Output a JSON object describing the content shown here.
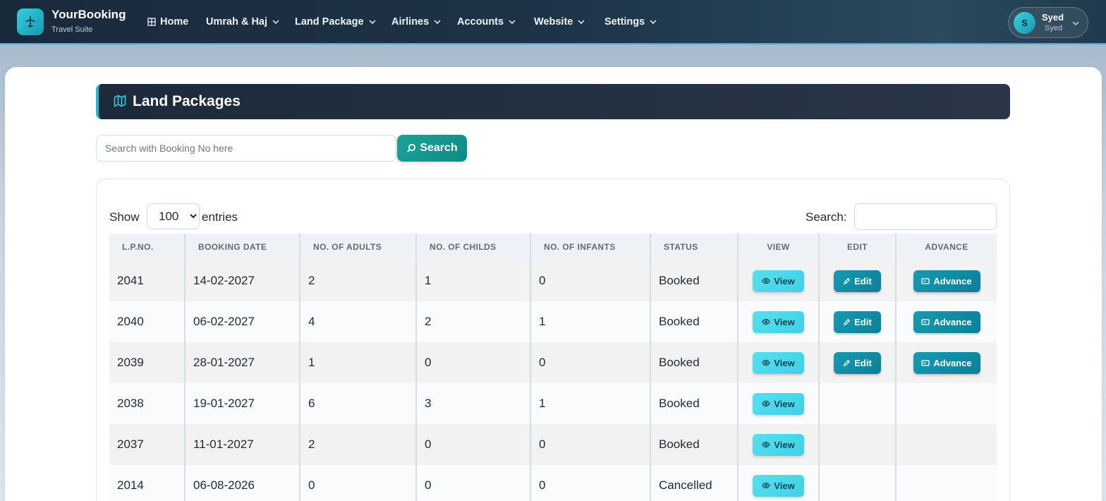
{
  "brand": {
    "name": "YourBooking",
    "subtitle": "Travel Suite"
  },
  "nav": {
    "items": [
      {
        "label": "Home",
        "icon": "grid-icon",
        "dropdown": false
      },
      {
        "label": "Umrah & Haj",
        "dropdown": true
      },
      {
        "label": "Land Package",
        "dropdown": true
      },
      {
        "label": "Airlines",
        "dropdown": true
      },
      {
        "label": "Accounts",
        "dropdown": true
      },
      {
        "label": "Website",
        "dropdown": true
      },
      {
        "label": "Settings",
        "dropdown": true
      }
    ]
  },
  "user": {
    "initial": "S",
    "name": "Syed",
    "role": "Syed"
  },
  "page": {
    "title": "Land Packages",
    "title_icon": "map-icon"
  },
  "search": {
    "placeholder": "Search with Booking No here",
    "button_label": "Search"
  },
  "table_controls": {
    "show_label": "Show",
    "entries_value": "100",
    "entries_label": "entries",
    "search_label": "Search:"
  },
  "table": {
    "headers": [
      "L.P.NO.",
      "BOOKING DATE",
      "NO. OF ADULTS",
      "NO. OF CHILDS",
      "NO. OF INFANTS",
      "STATUS",
      "VIEW",
      "EDIT",
      "ADVANCE"
    ],
    "button_labels": {
      "view": "View",
      "edit": "Edit",
      "advance": "Advance"
    },
    "rows": [
      {
        "lp_no": "2041",
        "date": "14-02-2027",
        "adults": "2",
        "childs": "1",
        "infants": "0",
        "status": "Booked",
        "editable": true
      },
      {
        "lp_no": "2040",
        "date": "06-02-2027",
        "adults": "4",
        "childs": "2",
        "infants": "1",
        "status": "Booked",
        "editable": true
      },
      {
        "lp_no": "2039",
        "date": "28-01-2027",
        "adults": "1",
        "childs": "0",
        "infants": "0",
        "status": "Booked",
        "editable": true
      },
      {
        "lp_no": "2038",
        "date": "19-01-2027",
        "adults": "6",
        "childs": "3",
        "infants": "1",
        "status": "Booked",
        "editable": false
      },
      {
        "lp_no": "2037",
        "date": "11-01-2027",
        "adults": "2",
        "childs": "0",
        "infants": "0",
        "status": "Booked",
        "editable": false
      },
      {
        "lp_no": "2014",
        "date": "06-08-2026",
        "adults": "0",
        "childs": "0",
        "infants": "0",
        "status": "Cancelled",
        "editable": false
      }
    ]
  },
  "colors": {
    "accent": "#2bb4c9",
    "nav_bg": "#1a2a3d",
    "search_button": "#1aa39a",
    "view_button": "#4fd8ec",
    "edit_button": "#1296ae"
  }
}
